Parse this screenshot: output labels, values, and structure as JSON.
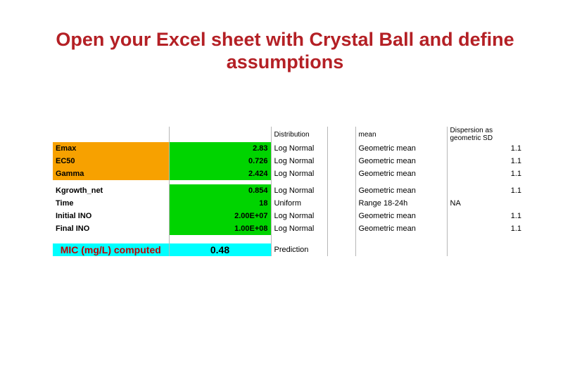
{
  "title": "Open your Excel sheet with Crystal Ball and define assumptions",
  "hdr": {
    "distribution": "Distribution",
    "mean": "mean",
    "dispersion": "Dispersion as geometric SD"
  },
  "r1": {
    "label": "Emax",
    "val": "2.83",
    "dist": "Log Normal",
    "mean": "Geometric mean",
    "disp": "1.1"
  },
  "r2": {
    "label": "EC50",
    "val": "0.726",
    "dist": "Log Normal",
    "mean": "Geometric mean",
    "disp": "1.1"
  },
  "r3": {
    "label": "Gamma",
    "val": "2.424",
    "dist": "Log Normal",
    "mean": "Geometric mean",
    "disp": "1.1"
  },
  "r4": {
    "label": "Kgrowth_net",
    "val": "0.854",
    "dist": "Log Normal",
    "mean": "Geometric mean",
    "disp": "1.1"
  },
  "r5": {
    "label": "Time",
    "val": "18",
    "dist": "Uniform",
    "mean": "Range 18-24h",
    "disp": "NA"
  },
  "r6": {
    "label": "Initial INO",
    "val": "2.00E+07",
    "dist": "Log Normal",
    "mean": "Geometric mean",
    "disp": "1.1"
  },
  "r7": {
    "label": "Final INO",
    "val": "1.00E+08",
    "dist": "Log Normal",
    "mean": "Geometric mean",
    "disp": "1.1"
  },
  "out": {
    "label": "MIC (mg/L) computed",
    "val": "0.48",
    "note": "Prediction"
  }
}
